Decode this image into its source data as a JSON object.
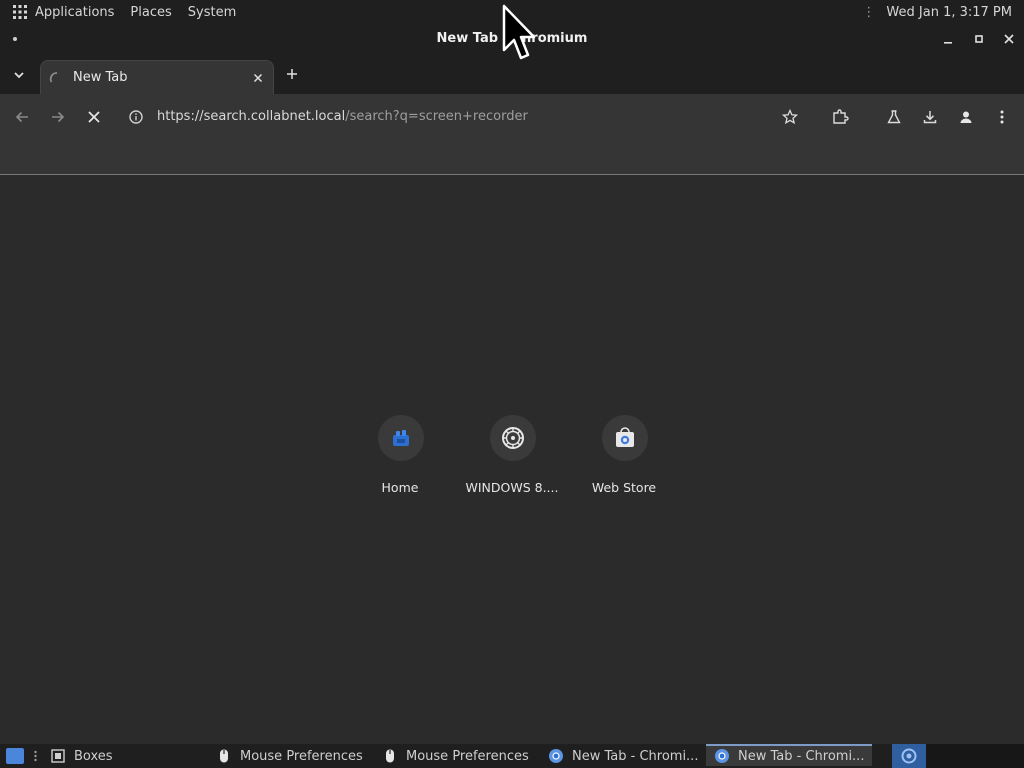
{
  "panel": {
    "menus": [
      "Applications",
      "Places",
      "System"
    ],
    "clock": "Wed Jan  1,  3:17 PM",
    "icons": {
      "apps": "app-grid-icon",
      "overflow": "vertical-dots-icon"
    }
  },
  "window": {
    "title": "New Tab - Chromium",
    "controls": [
      "minimize",
      "maximize",
      "close"
    ]
  },
  "tabs": [
    {
      "title": "New Tab",
      "loading": true,
      "active": true
    }
  ],
  "toolbar": {
    "url_host": "https://search.collabnet.local",
    "url_path": "/search?q=screen+recorder",
    "icons": [
      "back-icon",
      "forward-icon",
      "stop-icon",
      "site-info-icon",
      "bookmark-star-icon",
      "extensions-icon",
      "labs-flask-icon",
      "download-icon",
      "profile-icon",
      "menu-icon"
    ]
  },
  "shortcuts": [
    {
      "label": "Home",
      "icon": "home-favicon"
    },
    {
      "label": "WINDOWS 8....",
      "icon": "gear-wheel-favicon"
    },
    {
      "label": "Web Store",
      "icon": "web-store-favicon"
    }
  ],
  "taskbar": {
    "items": [
      {
        "label": "Boxes",
        "icon": "boxes-icon"
      },
      {
        "label": "Mouse Preferences",
        "icon": "mouse-icon"
      },
      {
        "label": "Mouse Preferences",
        "icon": "mouse-icon"
      },
      {
        "label": "New Tab - Chromi...",
        "icon": "chromium-icon"
      },
      {
        "label": "New Tab - Chromi...",
        "icon": "chromium-icon",
        "active": true
      }
    ]
  },
  "colors": {
    "panel_bg": "#1f1f1f",
    "toolbar_bg": "#353535",
    "page_bg": "#2b2b2b",
    "accent_blue": "#4a86d9"
  }
}
